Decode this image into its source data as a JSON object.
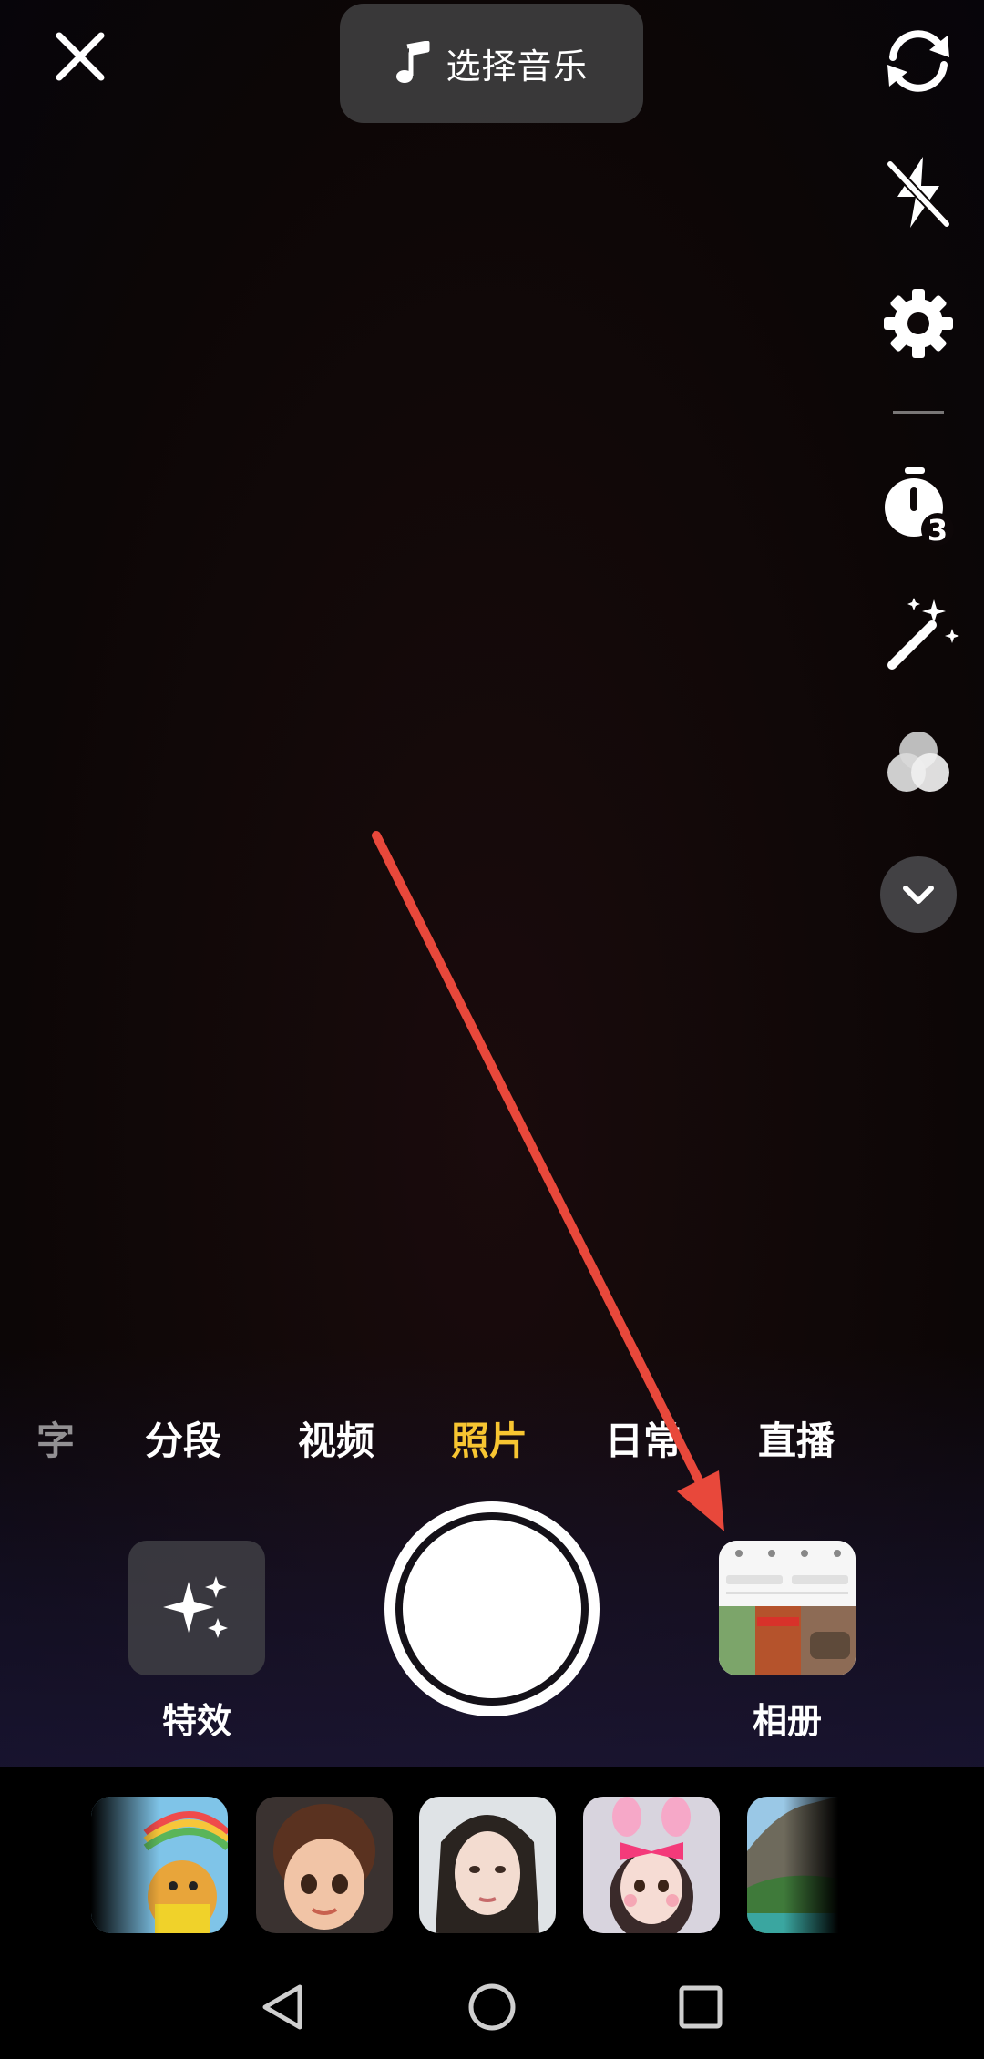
{
  "top_bar": {
    "close_icon": "close-icon",
    "music_label": "选择音乐",
    "music_icon": "music-note-icon"
  },
  "side_toolbar": {
    "icons": [
      "flip-camera-icon",
      "flash-off-icon",
      "settings-gear-icon",
      "timer-icon",
      "magic-wand-icon",
      "filters-icon",
      "chevron-down-icon"
    ],
    "timer_value": "3"
  },
  "modes": {
    "items": [
      "字",
      "分段",
      "视频",
      "照片",
      "日常",
      "直播"
    ],
    "active": "照片"
  },
  "bottom_controls": {
    "effects_label": "特效",
    "album_label": "相册"
  },
  "colors": {
    "active_mode": "#f7c531",
    "annotation_arrow": "#e8483b"
  },
  "nav": {
    "icons": [
      "back-triangle-icon",
      "home-circle-icon",
      "recents-square-icon"
    ]
  }
}
